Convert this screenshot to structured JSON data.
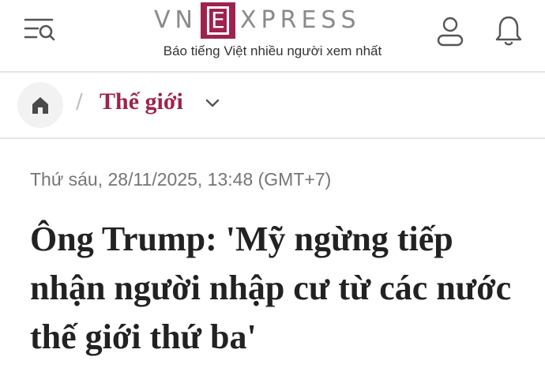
{
  "header": {
    "logo": {
      "left": "VN",
      "box": "E",
      "right": "XPRESS"
    },
    "tagline": "Báo tiếng Việt nhiều người xem nhất",
    "icons": {
      "menu": "menu-search-icon",
      "user": "user-icon",
      "notifications": "bell-icon"
    }
  },
  "breadcrumb": {
    "home_icon": "home-icon",
    "separator": "/",
    "section": "Thế giới",
    "dropdown_icon": "chevron-down-icon"
  },
  "article": {
    "date": "Thứ sáu, 28/11/2025, 13:48 (GMT+7)",
    "title": "Ông Trump: 'Mỹ ngừng tiếp nhận người nhập cư từ các nước thế giới thứ ba'"
  },
  "colors": {
    "brand": "#9f224e",
    "logo_gray": "#8a8a8a",
    "date_gray": "#757575",
    "divider": "#e5e5e5"
  }
}
